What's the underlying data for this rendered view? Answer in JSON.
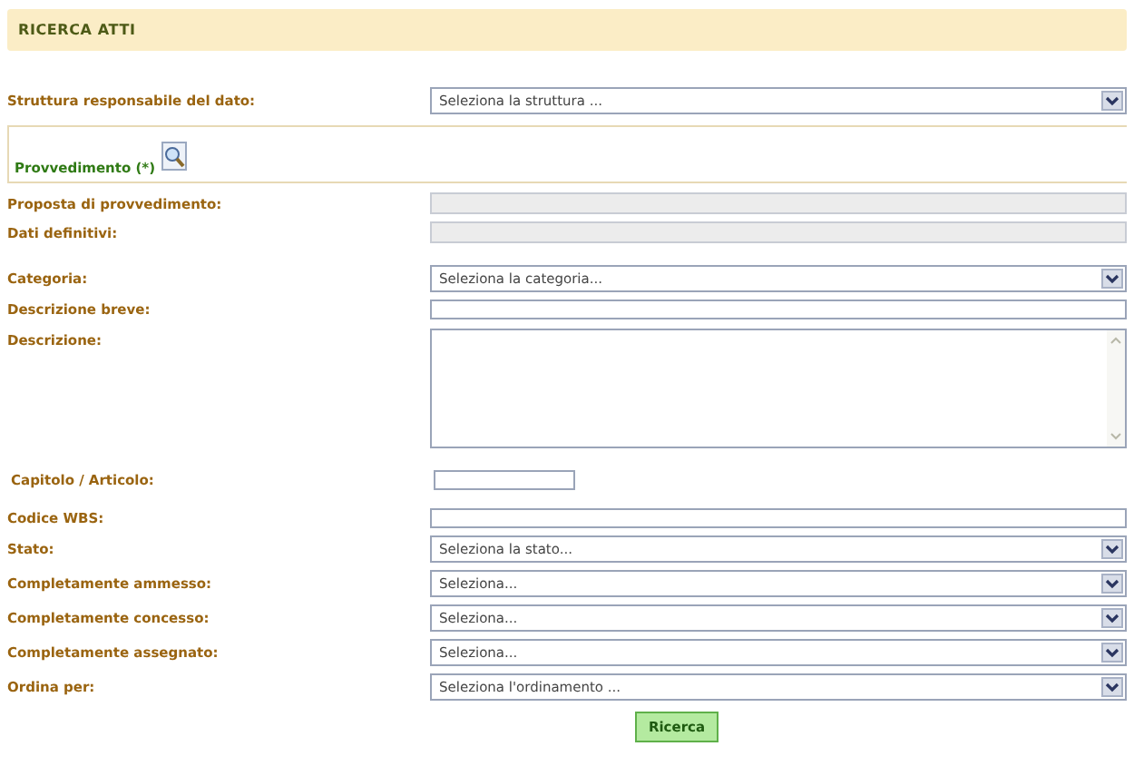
{
  "header": {
    "title": "RICERCA ATTI"
  },
  "struttura": {
    "label": "Struttura responsabile del dato:",
    "kind": "select",
    "value": "Seleziona la struttura ..."
  },
  "section": {
    "title": "Provvedimento (*)"
  },
  "groups": [
    [
      {
        "label": "Proposta di provvedimento:",
        "kind": "disabled"
      },
      {
        "label": "Dati definitivi:",
        "kind": "disabled"
      }
    ],
    [
      {
        "label": "Categoria:",
        "kind": "select",
        "value": "Seleziona la categoria..."
      },
      {
        "label": "Descrizione breve:",
        "kind": "text"
      },
      {
        "label": "Descrizione:",
        "kind": "textarea"
      }
    ],
    [
      {
        "label": "Capitolo / Articolo:",
        "kind": "short"
      }
    ],
    [
      {
        "label": "Codice WBS:",
        "kind": "text"
      },
      {
        "label": "Stato:",
        "kind": "select",
        "value": "Seleziona la stato..."
      },
      {
        "label": "Completamente ammesso:",
        "kind": "select",
        "value": "Seleziona..."
      },
      {
        "label": "Completamente concesso:",
        "kind": "select",
        "value": "Seleziona..."
      },
      {
        "label": "Completamente assegnato:",
        "kind": "select",
        "value": "Seleziona..."
      },
      {
        "label": "Ordina per:",
        "kind": "select",
        "value": "Seleziona l'ordinamento ..."
      }
    ]
  ],
  "button": {
    "label": "Ricerca"
  }
}
